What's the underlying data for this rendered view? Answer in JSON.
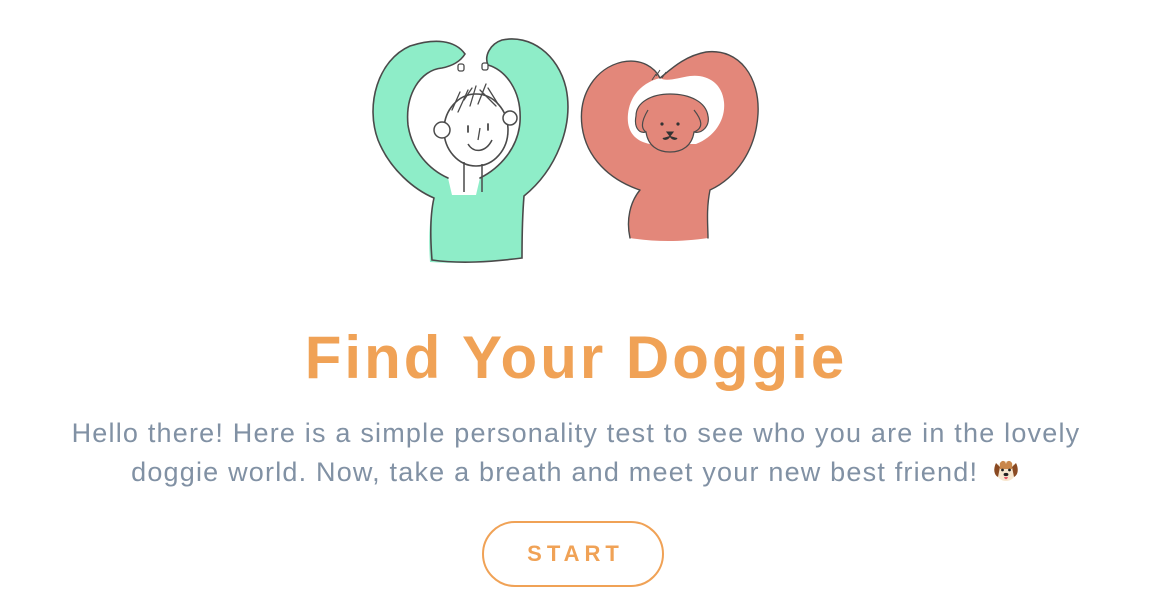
{
  "hero": {
    "illustration": "person-and-dog-heart-arms",
    "colors": {
      "person_shirt": "#8eedc8",
      "dog": "#e3877a",
      "outline": "#4a4a4a"
    }
  },
  "title": "Find Your Doggie",
  "intro": {
    "line1": "Hello there! Here is a simple personality test to see who you are in the lovely",
    "line2": "doggie world. Now, take a breath and meet your new best friend!",
    "emoji_icon": "dog-face-icon"
  },
  "start_button": {
    "label": "START"
  },
  "theme": {
    "accent": "#f0a256",
    "body_text": "#8191a4",
    "background": "#ffffff"
  }
}
